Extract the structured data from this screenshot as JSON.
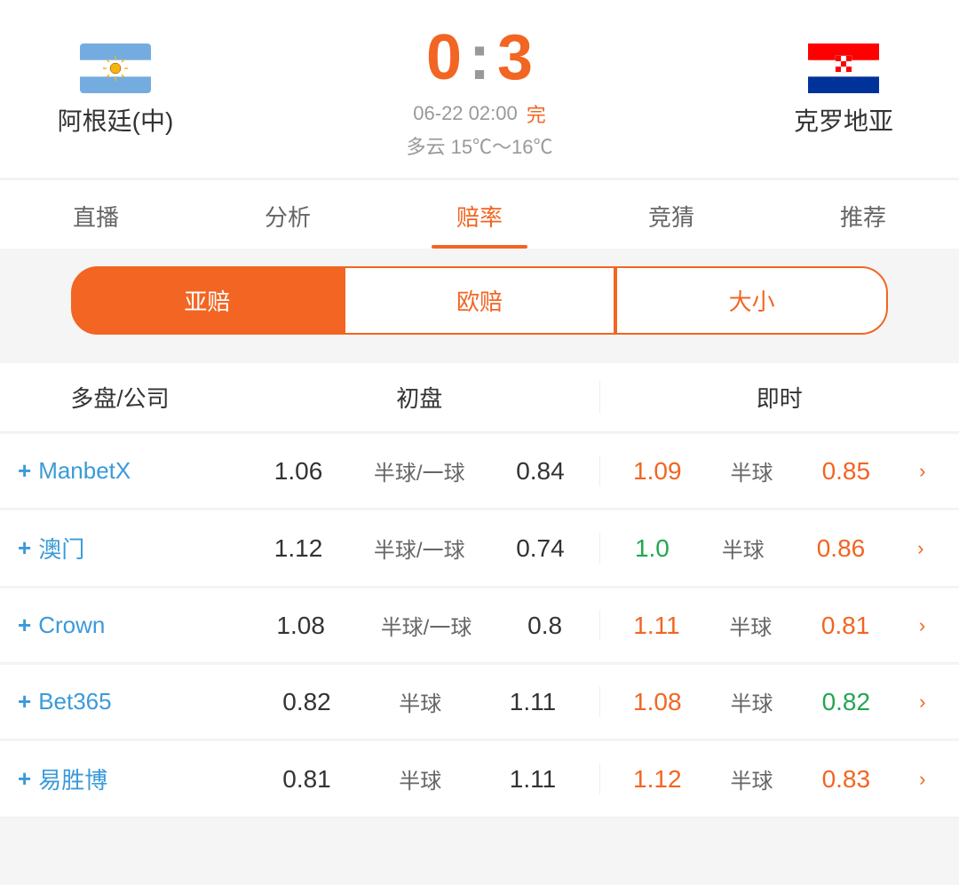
{
  "header": {
    "team_home": "阿根廷(中)",
    "team_away": "克罗地亚",
    "score_home": "0",
    "score_colon": ":",
    "score_away": "3",
    "match_date": "06-22 02:00",
    "match_status": "完",
    "weather": "多云  15℃～16℃"
  },
  "tabs": [
    {
      "label": "直播",
      "active": false
    },
    {
      "label": "分析",
      "active": false
    },
    {
      "label": "赔率",
      "active": true
    },
    {
      "label": "竞猜",
      "active": false
    },
    {
      "label": "推荐",
      "active": false
    }
  ],
  "subtabs": [
    {
      "label": "亚赔",
      "active": true
    },
    {
      "label": "欧赔",
      "active": false
    },
    {
      "label": "大小",
      "active": false
    }
  ],
  "table": {
    "col_company": "多盘/公司",
    "col_initial": "初盘",
    "col_realtime": "即时",
    "rows": [
      {
        "company": "ManbetX",
        "init_home": "1.06",
        "init_mid": "半球/一球",
        "init_away": "0.84",
        "rt_home": "1.09",
        "rt_home_color": "orange",
        "rt_mid": "半球",
        "rt_mid_color": "green",
        "rt_away": "0.85",
        "rt_away_color": "orange"
      },
      {
        "company": "澳门",
        "init_home": "1.12",
        "init_mid": "半球/一球",
        "init_away": "0.74",
        "rt_home": "1.0",
        "rt_home_color": "green",
        "rt_mid": "半球",
        "rt_mid_color": "green",
        "rt_away": "0.86",
        "rt_away_color": "orange"
      },
      {
        "company": "Crown",
        "init_home": "1.08",
        "init_mid": "半球/一球",
        "init_away": "0.8",
        "rt_home": "1.11",
        "rt_home_color": "orange",
        "rt_mid": "半球",
        "rt_mid_color": "green",
        "rt_away": "0.81",
        "rt_away_color": "orange"
      },
      {
        "company": "Bet365",
        "init_home": "0.82",
        "init_mid": "半球",
        "init_away": "1.11",
        "rt_home": "1.08",
        "rt_home_color": "orange",
        "rt_mid": "半球",
        "rt_mid_color": "green",
        "rt_away": "0.82",
        "rt_away_color": "green"
      },
      {
        "company": "易胜博",
        "init_home": "0.81",
        "init_mid": "半球",
        "init_away": "1.11",
        "rt_home": "1.12",
        "rt_home_color": "orange",
        "rt_mid": "半球",
        "rt_mid_color": "green",
        "rt_away": "0.83",
        "rt_away_color": "orange"
      }
    ]
  }
}
